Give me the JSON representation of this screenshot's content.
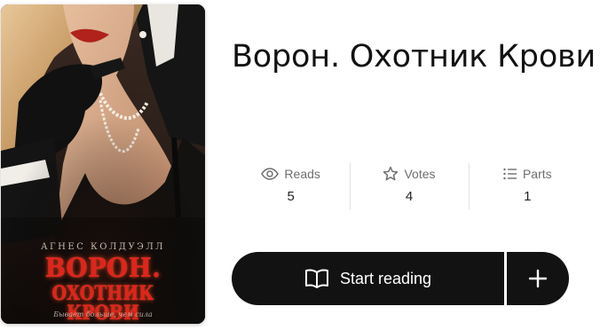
{
  "cover": {
    "author": "АГНЕС КОЛДУЭЛЛ",
    "title_line1": "ВОРОН.",
    "title_line2": "ОХОТНИК КРОВИ",
    "tagline": "Бывает больше, чем сила"
  },
  "story": {
    "title": "Ворон. Охотник Крови"
  },
  "stats": [
    {
      "icon": "eye-icon",
      "label": "Reads",
      "value": "5"
    },
    {
      "icon": "star-icon",
      "label": "Votes",
      "value": "4"
    },
    {
      "icon": "list-icon",
      "label": "Parts",
      "value": "1"
    }
  ],
  "actions": {
    "start_reading_label": "Start reading",
    "start_reading_icon": "open-book-icon",
    "add_icon": "plus-icon"
  },
  "colors": {
    "button_bg": "#121212",
    "title_text": "#121212",
    "stat_label": "#6f6f6f",
    "cover_title_red": "#e0241c"
  }
}
